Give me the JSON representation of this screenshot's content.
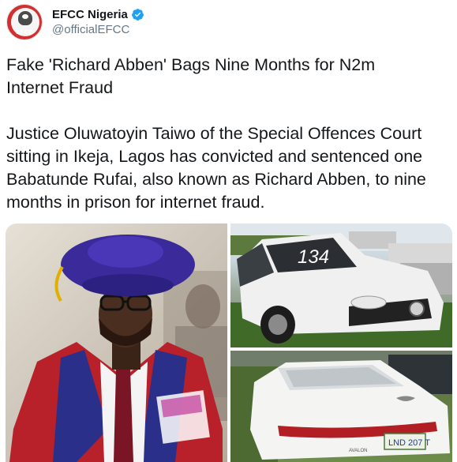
{
  "account": {
    "display_name": "EFCC Nigeria",
    "handle": "@officialEFCC",
    "avatar_text": "EFCC"
  },
  "tweet": {
    "text": "Fake 'Richard Abben' Bags Nine Months for N2m\nInternet Fraud\n\nJustice Oluwatoyin Taiwo of the Special Offences Court sitting in Ikeja, Lagos has convicted and sentenced one Babatunde Rufai, also known as Richard Abben, to nine months in prison for internet fraud."
  },
  "media": {
    "car_windshield_mark": "134",
    "plate_text": "LND 207 T",
    "car_badge": "AVALON"
  },
  "colors": {
    "verified_blue": "#1da1f2",
    "text_primary": "#14171a",
    "text_secondary": "#657786"
  }
}
